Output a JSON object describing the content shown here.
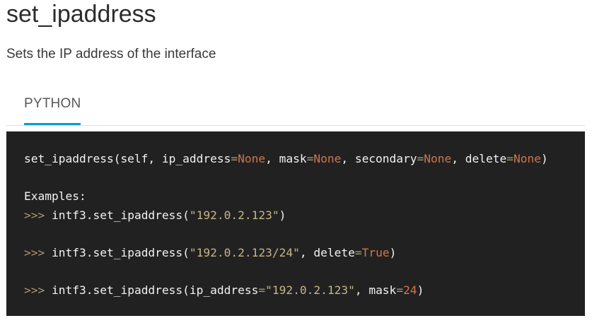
{
  "page": {
    "title": "set_ipaddress",
    "description": "Sets the IP address of the interface"
  },
  "tabs": [
    {
      "label": "PYTHON",
      "active": true
    }
  ],
  "code": {
    "signature": {
      "fn": "set_ipaddress(self, ip_address",
      "eq1": "=",
      "v1": "None",
      "p2": ", mask",
      "eq2": "=",
      "v2": "None",
      "p3": ", secondary",
      "eq3": "=",
      "v3": "None",
      "p4": ", delete",
      "eq4": "=",
      "v4": "None",
      "close": ")"
    },
    "examples_label": "Examples:",
    "example1": {
      "prompt": ">>>",
      "call": " intf3.set_ipaddress(",
      "arg": "\"192.0.2.123\"",
      "close": ")"
    },
    "example2": {
      "prompt": ">>>",
      "call": " intf3.set_ipaddress(",
      "arg": "\"192.0.2.123/24\"",
      "mid": ", delete",
      "eq": "=",
      "val": "True",
      "close": ")"
    },
    "example3": {
      "prompt": ">>>",
      "call": " intf3.set_ipaddress(ip_address",
      "eq1": "=",
      "arg": "\"192.0.2.123\"",
      "mid": ", mask",
      "eq2": "=",
      "val": "24",
      "close": ")"
    }
  },
  "colors": {
    "code_background": "#212121",
    "tab_underline": "#049fd9",
    "keyword": "#d0764c",
    "string": "#c5b686",
    "operator": "#aa9a6f"
  }
}
